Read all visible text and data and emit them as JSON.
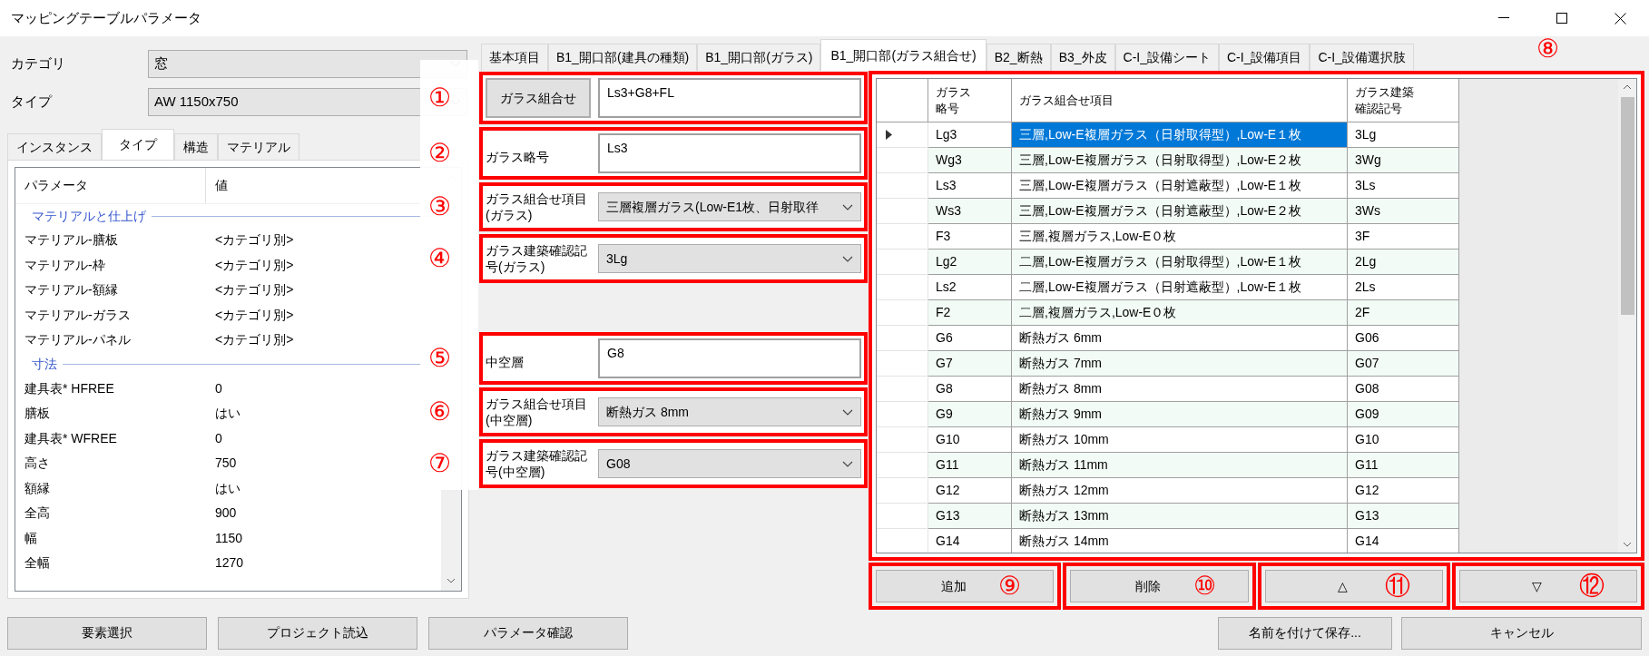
{
  "window": {
    "title": "マッピングテーブルパラメータ"
  },
  "category": {
    "label": "カテゴリ",
    "value": "窓"
  },
  "type": {
    "label": "タイプ",
    "value": "AW 1150x750"
  },
  "property_tabs": [
    {
      "label": "インスタンス",
      "selected": false
    },
    {
      "label": "タイプ",
      "selected": true
    },
    {
      "label": "構造",
      "selected": false
    },
    {
      "label": "マテリアル",
      "selected": false
    }
  ],
  "properties": {
    "columns": [
      "パラメータ",
      "値"
    ],
    "groups": [
      {
        "name": "マテリアルと仕上げ",
        "rows": [
          {
            "name": "マテリアル-膳板",
            "value": "<カテゴリ別>"
          },
          {
            "name": "マテリアル-枠",
            "value": "<カテゴリ別>"
          },
          {
            "name": "マテリアル-額縁",
            "value": "<カテゴリ別>"
          },
          {
            "name": "マテリアル-ガラス",
            "value": "<カテゴリ別>"
          },
          {
            "name": "マテリアル-パネル",
            "value": "<カテゴリ別>"
          }
        ]
      },
      {
        "name": "寸法",
        "rows": [
          {
            "name": "建具表* HFREE",
            "value": "0"
          },
          {
            "name": "膳板",
            "value": "はい"
          },
          {
            "name": "建具表* WFREE",
            "value": "0"
          },
          {
            "name": "高さ",
            "value": "750"
          },
          {
            "name": "額縁",
            "value": "はい"
          },
          {
            "name": "全高",
            "value": "900"
          },
          {
            "name": "幅",
            "value": "1150"
          },
          {
            "name": "全幅",
            "value": "1270"
          }
        ]
      }
    ]
  },
  "tabs": [
    {
      "label": "基本項目",
      "selected": false
    },
    {
      "label": "B1_開口部(建具の種類)",
      "selected": false
    },
    {
      "label": "B1_開口部(ガラス)",
      "selected": false
    },
    {
      "label": "B1_開口部(ガラス組合せ)",
      "selected": true
    },
    {
      "label": "B2_断熱",
      "selected": false
    },
    {
      "label": "B3_外皮",
      "selected": false
    },
    {
      "label": "C-I_設備シート",
      "selected": false
    },
    {
      "label": "C-I_設備項目",
      "selected": false
    },
    {
      "label": "C-I_設備選択肢",
      "selected": false
    }
  ],
  "tabs_marker": "⑧",
  "form_groups": [
    [
      {
        "kind": "button_text",
        "button": "ガラス組合せ",
        "value": "Ls3+G8+FL",
        "marker": "①"
      },
      {
        "kind": "text",
        "label": "ガラス略号",
        "value": "Ls3",
        "marker": "②"
      },
      {
        "kind": "select",
        "label": "ガラス組合せ項目(ガラス)",
        "value": "三層複層ガラス(Low-E1枚、日射取徉",
        "marker": "③"
      },
      {
        "kind": "select",
        "label": "ガラス建築確認記号(ガラス)",
        "value": "3Lg",
        "marker": "④"
      }
    ],
    [
      {
        "kind": "text",
        "label": "中空層",
        "value": "G8",
        "marker": "⑤"
      },
      {
        "kind": "select",
        "label": "ガラス組合せ項目(中空層)",
        "value": "断熱ガス 8mm",
        "marker": "⑥"
      },
      {
        "kind": "select",
        "label": "ガラス建築確認記号(中空層)",
        "value": "G08",
        "marker": "⑦"
      }
    ]
  ],
  "table": {
    "columns": [
      "ガラス略号",
      "ガラス組合せ項目",
      "ガラス建築確認記号"
    ],
    "rows": [
      {
        "cells": [
          "Lg3",
          "三層,Low-E複層ガラス（日射取得型）,Low-E１枚",
          "3Lg"
        ],
        "selected": true
      },
      {
        "cells": [
          "Wg3",
          "三層,Low-E複層ガラス（日射取得型）,Low-E２枚",
          "3Wg"
        ],
        "selected": false
      },
      {
        "cells": [
          "Ls3",
          "三層,Low-E複層ガラス（日射遮蔽型）,Low-E１枚",
          "3Ls"
        ],
        "selected": false
      },
      {
        "cells": [
          "Ws3",
          "三層,Low-E複層ガラス（日射遮蔽型）,Low-E２枚",
          "3Ws"
        ],
        "selected": false
      },
      {
        "cells": [
          "F3",
          "三層,複層ガラス,Low-E０枚",
          "3F"
        ],
        "selected": false
      },
      {
        "cells": [
          "Lg2",
          "二層,Low-E複層ガラス（日射取得型）,Low-E１枚",
          "2Lg"
        ],
        "selected": false
      },
      {
        "cells": [
          "Ls2",
          "二層,Low-E複層ガラス（日射遮蔽型）,Low-E１枚",
          "2Ls"
        ],
        "selected": false
      },
      {
        "cells": [
          "F2",
          "二層,複層ガラス,Low-E０枚",
          "2F"
        ],
        "selected": false
      },
      {
        "cells": [
          "G6",
          "断熱ガス 6mm",
          "G06"
        ],
        "selected": false
      },
      {
        "cells": [
          "G7",
          "断熱ガス 7mm",
          "G07"
        ],
        "selected": false
      },
      {
        "cells": [
          "G8",
          "断熱ガス 8mm",
          "G08"
        ],
        "selected": false
      },
      {
        "cells": [
          "G9",
          "断熱ガス 9mm",
          "G09"
        ],
        "selected": false
      },
      {
        "cells": [
          "G10",
          "断熱ガス 10mm",
          "G10"
        ],
        "selected": false
      },
      {
        "cells": [
          "G11",
          "断熱ガス 11mm",
          "G11"
        ],
        "selected": false
      },
      {
        "cells": [
          "G12",
          "断熱ガス 12mm",
          "G12"
        ],
        "selected": false
      },
      {
        "cells": [
          "G13",
          "断熱ガス 13mm",
          "G13"
        ],
        "selected": false
      },
      {
        "cells": [
          "G14",
          "断熱ガス 14mm",
          "G14"
        ],
        "selected": false
      }
    ]
  },
  "table_buttons": [
    {
      "label": "追加",
      "marker": "⑨"
    },
    {
      "label": "削除",
      "marker": "⑩"
    },
    {
      "label": "△",
      "marker": "⑪"
    },
    {
      "label": "▽",
      "marker": "⑫"
    }
  ],
  "bottom_left_buttons": [
    "要素選択",
    "プロジェクト読込",
    "パラメータ確認"
  ],
  "bottom_right_buttons": [
    "名前を付けて保存...",
    "キャンセル"
  ]
}
